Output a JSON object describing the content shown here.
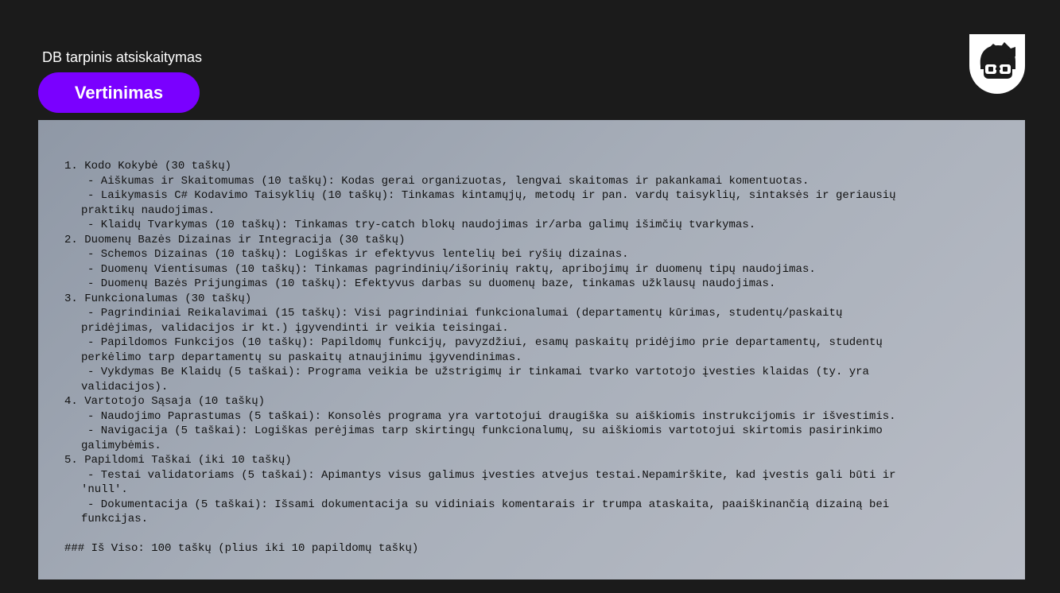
{
  "header": {
    "title": "DB tarpinis atsiskaitymas",
    "pill_label": "Vertinimas",
    "logo_icon": "nerd-glasses-logo-icon"
  },
  "colors": {
    "background": "#1b1b1b",
    "accent": "#7a00ff"
  },
  "content": {
    "lines": [
      "1. Kodo Kokybė (30 taškų)",
      "- Aiškumas ir Skaitomumas (10 taškų): Kodas gerai organizuotas, lengvai skaitomas ir pakankamai komentuotas.",
      "- Laikymasis C# Kodavimo Taisyklių (10 taškų): Tinkamas kintamųjų, metodų ir pan. vardų taisyklių, sintaksės ir geriausių",
      "praktikų naudojimas.",
      "- Klaidų Tvarkymas (10 taškų): Tinkamas try-catch blokų naudojimas ir/arba galimų išimčių tvarkymas.",
      "2. Duomenų Bazės Dizainas ir Integracija (30 taškų)",
      "- Schemos Dizainas (10 taškų): Logiškas ir efektyvus lentelių bei ryšių dizainas.",
      "- Duomenų Vientisumas (10 taškų): Tinkamas pagrindinių/išorinių raktų, apribojimų ir duomenų tipų naudojimas.",
      "- Duomenų Bazės Prijungimas (10 taškų): Efektyvus darbas su duomenų baze, tinkamas užklausų naudojimas.",
      "3. Funkcionalumas (30 taškų)",
      "- Pagrindiniai Reikalavimai (15 taškų): Visi pagrindiniai funkcionalumai (departamentų kūrimas, studentų/paskaitų",
      "pridėjimas, validacijos ir kt.) įgyvendinti ir veikia teisingai.",
      "- Papildomos Funkcijos (10 taškų): Papildomų funkcijų, pavyzdžiui, esamų paskaitų pridėjimo prie departamentų, studentų",
      "perkėlimo tarp departamentų su paskaitų atnaujinimu įgyvendinimas.",
      "- Vykdymas Be Klaidų (5 taškai): Programa veikia be užstrigimų ir tinkamai tvarko vartotojo įvesties klaidas (ty. yra",
      "validacijos).",
      "4. Vartotojo Sąsaja (10 taškų)",
      "- Naudojimo Paprastumas (5 taškai): Konsolės programa yra vartotojui draugiška su aiškiomis instrukcijomis ir išvestimis.",
      "- Navigacija (5 taškai): Logiškas perėjimas tarp skirtingų funkcionalumų, su aiškiomis vartotojui skirtomis pasirinkimo",
      "galimybėmis.",
      "5. Papildomi Taškai (iki 10 taškų)",
      "- Testai validatoriams (5 taškai): Apimantys visus galimus įvesties atvejus testai.Nepamirškite, kad įvestis gali būti ir",
      "'null'.",
      "- Dokumentacija (5 taškai): Išsami dokumentacija su vidiniais komentarais ir trumpa ataskaita, paaiškinančią dizainą bei",
      "funkcijas.",
      "",
      "### Iš Viso: 100 taškų (plius iki 10 papildomų taškų)"
    ]
  }
}
